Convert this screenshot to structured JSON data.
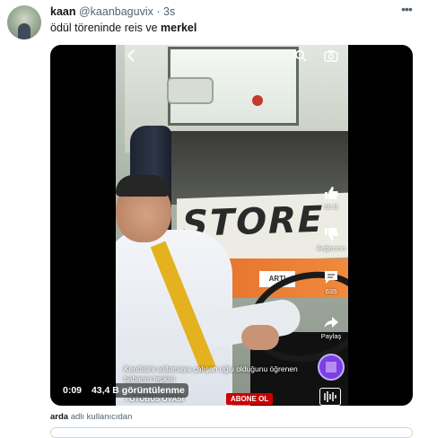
{
  "tweet": {
    "display_name": "kaan",
    "handle": "@kaanbaguvix",
    "separator": "·",
    "time": "3s",
    "more_icon": "more-icon",
    "text_plain": "ödül töreninde reis ve",
    "text_bold": "merkel"
  },
  "video": {
    "elapsed": "0:09",
    "views": "43,4 B görüntülenme",
    "bus_brand": "STORE",
    "band_label": "ARTI",
    "caption": "Kendisini sollamaya çalışan oğlu olduğunu öğrenen babanın tepkisi",
    "audio": "OTOBÜS OVASI",
    "subscribe_label": "ABONE OL",
    "rail": {
      "likes": "66 B",
      "dislike_label": "Beğenme",
      "comments": "635",
      "share_label": "Paylaş"
    }
  },
  "attribution": {
    "user": "arda",
    "suffix": "adlı kullanıcıdan"
  }
}
